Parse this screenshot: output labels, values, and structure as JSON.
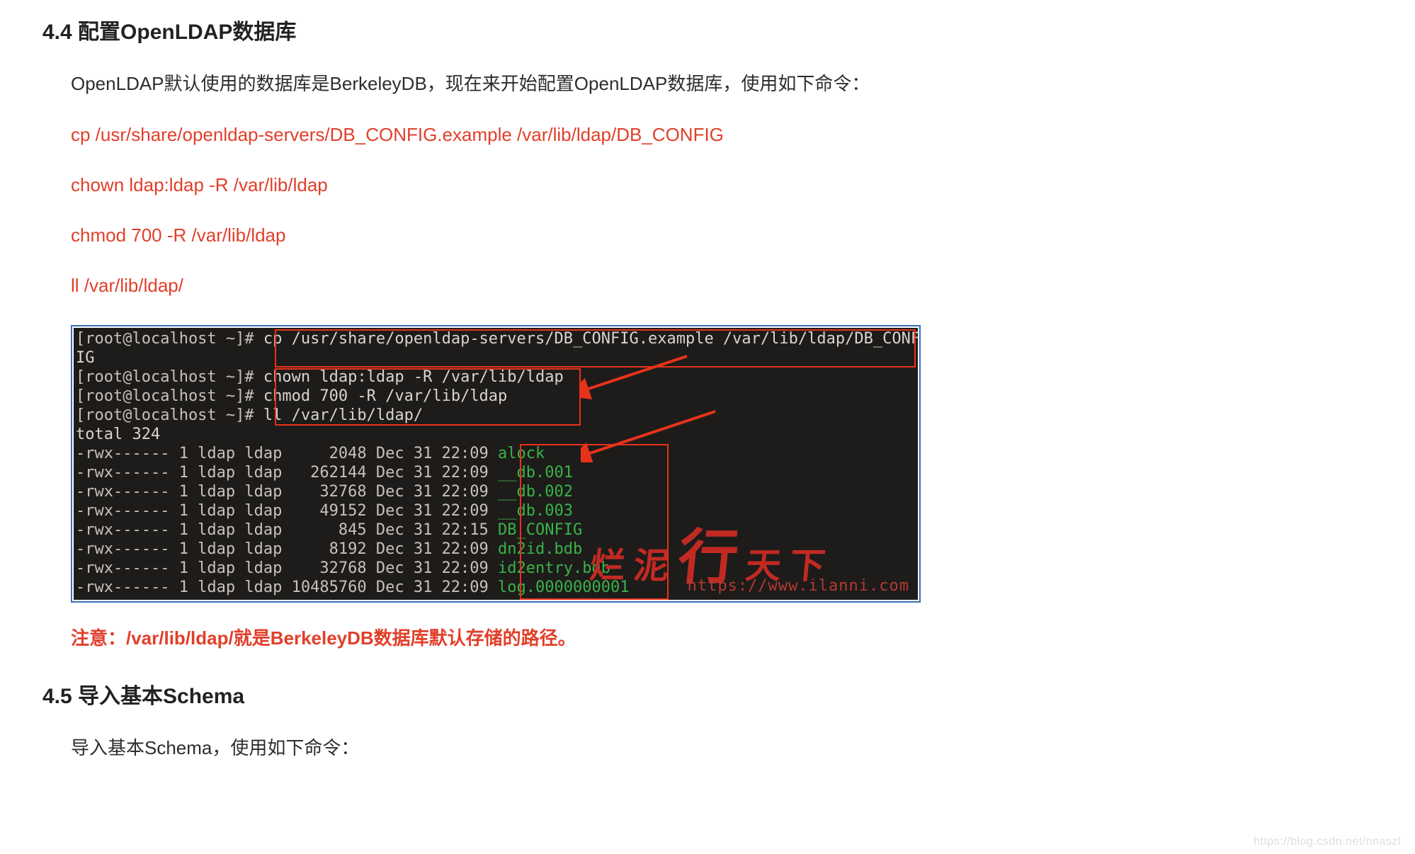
{
  "sections": {
    "s44": {
      "title": "4.4 配置OpenLDAP数据库",
      "intro": "OpenLDAP默认使用的数据库是BerkeleyDB，现在来开始配置OpenLDAP数据库，使用如下命令：",
      "commands": [
        "cp /usr/share/openldap-servers/DB_CONFIG.example /var/lib/ldap/DB_CONFIG",
        "chown ldap:ldap -R /var/lib/ldap",
        "chmod 700 -R /var/lib/ldap",
        "ll /var/lib/ldap/"
      ],
      "note": "注意：/var/lib/ldap/就是BerkeleyDB数据库默认存储的路径。"
    },
    "s45": {
      "title": "4.5 导入基本Schema",
      "intro": "导入基本Schema，使用如下命令："
    }
  },
  "terminal": {
    "prompt": "[root@localhost ~]#",
    "cmd_lines": [
      "cp /usr/share/openldap-servers/DB_CONFIG.example /var/lib/ldap/DB_CONF",
      "IG",
      "chown ldap:ldap -R /var/lib/ldap",
      "chmod 700 -R /var/lib/ldap",
      "ll /var/lib/ldap/"
    ],
    "total": "total 324",
    "rows": [
      {
        "attrs": "-rwx------ 1 ldap ldap     2048 Dec 31 22:09",
        "name": "alock"
      },
      {
        "attrs": "-rwx------ 1 ldap ldap   262144 Dec 31 22:09",
        "name": "__db.001"
      },
      {
        "attrs": "-rwx------ 1 ldap ldap    32768 Dec 31 22:09",
        "name": "__db.002"
      },
      {
        "attrs": "-rwx------ 1 ldap ldap    49152 Dec 31 22:09",
        "name": "__db.003"
      },
      {
        "attrs": "-rwx------ 1 ldap ldap      845 Dec 31 22:15",
        "name": "DB_CONFIG"
      },
      {
        "attrs": "-rwx------ 1 ldap ldap     8192 Dec 31 22:09",
        "name": "dn2id.bdb"
      },
      {
        "attrs": "-rwx------ 1 ldap ldap    32768 Dec 31 22:09",
        "name": "id2entry.bdb"
      },
      {
        "attrs": "-rwx------ 1 ldap ldap 10485760 Dec 31 22:09",
        "name": "log.0000000001"
      }
    ],
    "watermark_url": "https://www.ilanni.com",
    "watermark_cn": [
      "烂",
      "泥",
      "行",
      "天",
      "下"
    ],
    "page_watermark": "https://blog.csdn.net/nnaszl"
  }
}
